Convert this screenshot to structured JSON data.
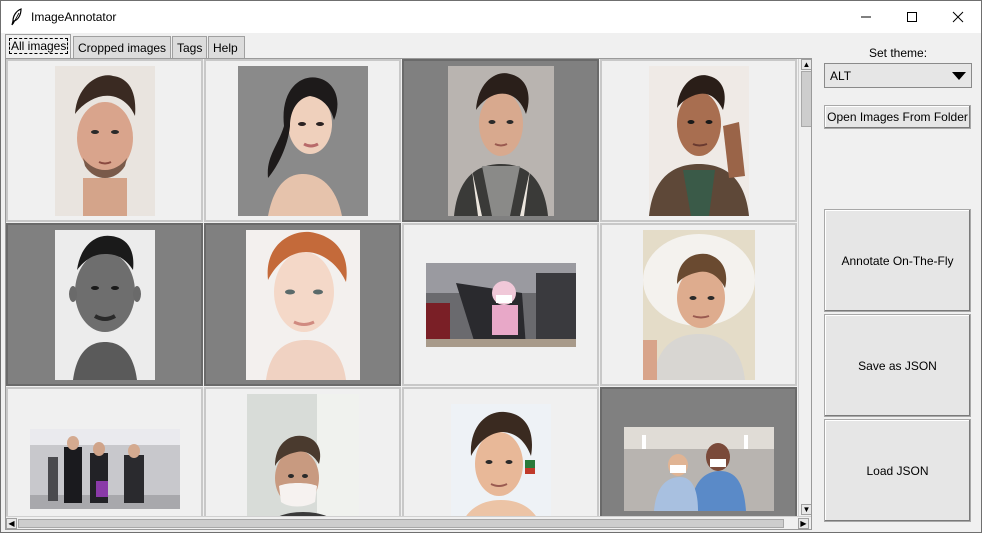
{
  "window": {
    "title": "ImageAnnotator",
    "icon": "feather-icon",
    "controls": [
      "minimize-icon",
      "maximize-icon",
      "close-icon"
    ]
  },
  "tabs": [
    {
      "label": "All images",
      "active": true
    },
    {
      "label": "Cropped images",
      "active": false
    },
    {
      "label": "Tags",
      "active": false
    },
    {
      "label": "Help",
      "active": false
    }
  ],
  "gallery": {
    "images": [
      {
        "description": "portrait-man-styled-hair",
        "selected": false
      },
      {
        "description": "portrait-woman-dark-hair",
        "selected": false
      },
      {
        "description": "portrait-young-man-jacket",
        "selected": true
      },
      {
        "description": "portrait-man-green-shirt",
        "selected": false
      },
      {
        "description": "portrait-man-black-and-white",
        "selected": true
      },
      {
        "description": "portrait-woman-red-hair",
        "selected": true
      },
      {
        "description": "child-in-stroller-masks",
        "selected": false
      },
      {
        "description": "young-man-lying-on-pillow",
        "selected": false
      },
      {
        "description": "people-with-masks-airport",
        "selected": false
      },
      {
        "description": "person-wearing-mask",
        "selected": false
      },
      {
        "description": "young-man-with-bracelet",
        "selected": false
      },
      {
        "description": "woman-carrying-child-masks",
        "selected": true
      }
    ]
  },
  "sidebar": {
    "theme_label": "Set theme:",
    "theme_value": "ALT",
    "open_button": "Open Images From Folder",
    "annotate_button": "Annotate On-The-Fly",
    "save_button": "Save as JSON",
    "load_button": "Load JSON"
  },
  "colors": {
    "selected_cell": "#808080",
    "cell_bg": "#f0f0f0",
    "window_bg": "#f0f0f0"
  }
}
